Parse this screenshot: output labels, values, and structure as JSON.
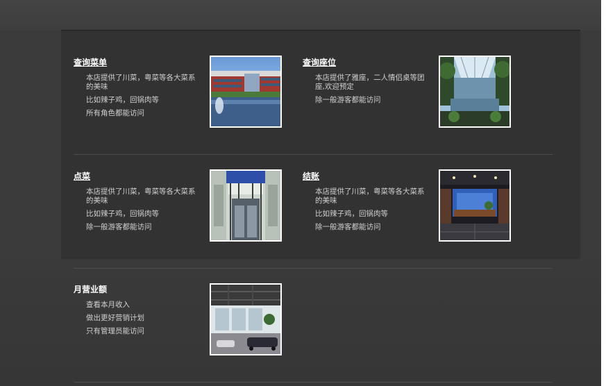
{
  "cards": [
    {
      "title": "查询菜单",
      "lines": [
        "本店提供了川菜，粤菜等各大菜系的美味",
        "比如辣子鸡，回锅肉等",
        "所有角色都能访问"
      ],
      "image": "office-building-photo"
    },
    {
      "title": "查询座位",
      "lines": [
        "本店提供了雅座，二人情侣桌等团座,欢迎预定",
        "除一般游客都能访问"
      ],
      "image": "glass-atrium-photo"
    },
    {
      "title": "点菜",
      "lines": [
        "本店提供了川菜，粤菜等各大菜系的美味",
        "比如辣子鸡，回锅肉等",
        "除一般游客都能访问"
      ],
      "image": "building-entrance-photo"
    },
    {
      "title": "结账",
      "lines": [
        "本店提供了川菜，粤菜等各大菜系的美味",
        "比如辣子鸡，回锅肉等",
        "除一般游客都能访问"
      ],
      "image": "lobby-interior-photo"
    },
    {
      "title": "月营业额",
      "lines": [
        "查看本月收入",
        "做出更好营销计划",
        "只有管理员能访问"
      ],
      "image": "car-showroom-photo"
    }
  ],
  "colors": {
    "background": "#3b3b3b",
    "panel": "#323232",
    "title_text": "#ffffff",
    "body_text": "#cfcfcf"
  }
}
